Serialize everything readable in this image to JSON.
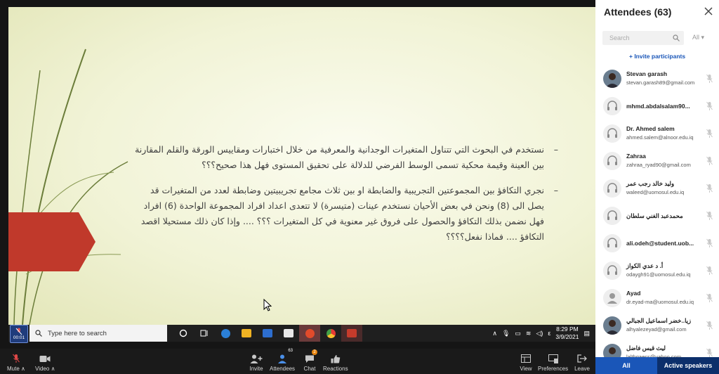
{
  "slide": {
    "bullets": [
      {
        "dash": "–",
        "text": "نستخدم في البحوث التي تتناول المتغيرات الوجدانية والمعرفية من خلال اختبارات ومقاييس الورقة والقلم المقارنة بين العينة وقيمة محكية تسمى الوسط الفرضي للدلالة على تحقيق المستوى فهل هذا صحيح؟؟؟"
      },
      {
        "dash": "–",
        "text": "نجري التكافؤ بين المجموعتين التجريبية والضابطة او بين ثلاث مجامع تجريبيتين وضابطة لعدد من المتغيرات قد يصل الى (8) ونحن في بعض الأحيان نستخدم عينات (متيسرة) لا تتعدى اعداد افراد المجموعة الواحدة (6) افراد فهل نضمن بذلك التكافؤ والحصول على فروق غير معنوية في كل المتغيرات ؟؟؟ .... وإذا كان ذلك مستحيلا اقصد التكافؤ .... فماذا نفعل؟؟؟؟"
      }
    ],
    "accent_color": "#c0392b"
  },
  "taskbar": {
    "search_placeholder": "Type here to search",
    "time": "8:29 PM",
    "date": "3/9/2021",
    "lang": "ε",
    "app_colors": [
      "#6a6a6a",
      "#2b7fd6",
      "#f0b323",
      "#2d6ecf",
      "#e8e8e8",
      "#c0392b",
      "#e04b2b",
      "#c63b2b"
    ]
  },
  "self_view": {
    "timer": "00:01"
  },
  "toolbar": {
    "mute_label": "Mute",
    "video_label": "Video",
    "invite_label": "Invite",
    "attendees_label": "Attendees",
    "attendees_count": "63",
    "chat_label": "Chat",
    "chat_count": "2",
    "reactions_label": "Reactions",
    "view_label": "View",
    "preferences_label": "Preferences",
    "leave_label": "Leave"
  },
  "panel": {
    "title": "Attendees (63)",
    "search_placeholder": "Search",
    "filter_label": "All",
    "invite_label": "+ Invite participants",
    "tab_all": "All",
    "tab_active": "Active speakers",
    "attendees": [
      {
        "name": "Stevan garash",
        "email": "stevan.garash89@gmail.com",
        "avatar": "photo"
      },
      {
        "name": "mhmd.abdalsalam90...",
        "email": "",
        "avatar": "headset"
      },
      {
        "name": "Dr. Ahmed salem",
        "email": "ahmed.salem@alnoor.edu.iq",
        "avatar": "headset"
      },
      {
        "name": "Zahraa",
        "email": "zahraa_ryad90@gmail.com",
        "avatar": "headset"
      },
      {
        "name": "وليد خالد رجب عمر",
        "email": "waleed@uomosul.edu.iq",
        "avatar": "headset"
      },
      {
        "name": "محمدعبد الغني سلطان",
        "email": "",
        "avatar": "headset"
      },
      {
        "name": "ali.odeh@student.uob...",
        "email": "",
        "avatar": "headset"
      },
      {
        "name": "أ. د عدي الكواز",
        "email": "odaygh91@uomosul.edu.iq",
        "avatar": "headset"
      },
      {
        "name": "Ayad",
        "email": "dr.eyad-ma@uomosul.edu.iq",
        "avatar": "person"
      },
      {
        "name": "زيا..خضر اسماعيل الجبالي",
        "email": "alhyalezeyad@gmail.com",
        "avatar": "photo"
      },
      {
        "name": "ليث قيس فاضل",
        "email": "lalthqaess@yahoo.com",
        "avatar": "photo"
      }
    ]
  }
}
